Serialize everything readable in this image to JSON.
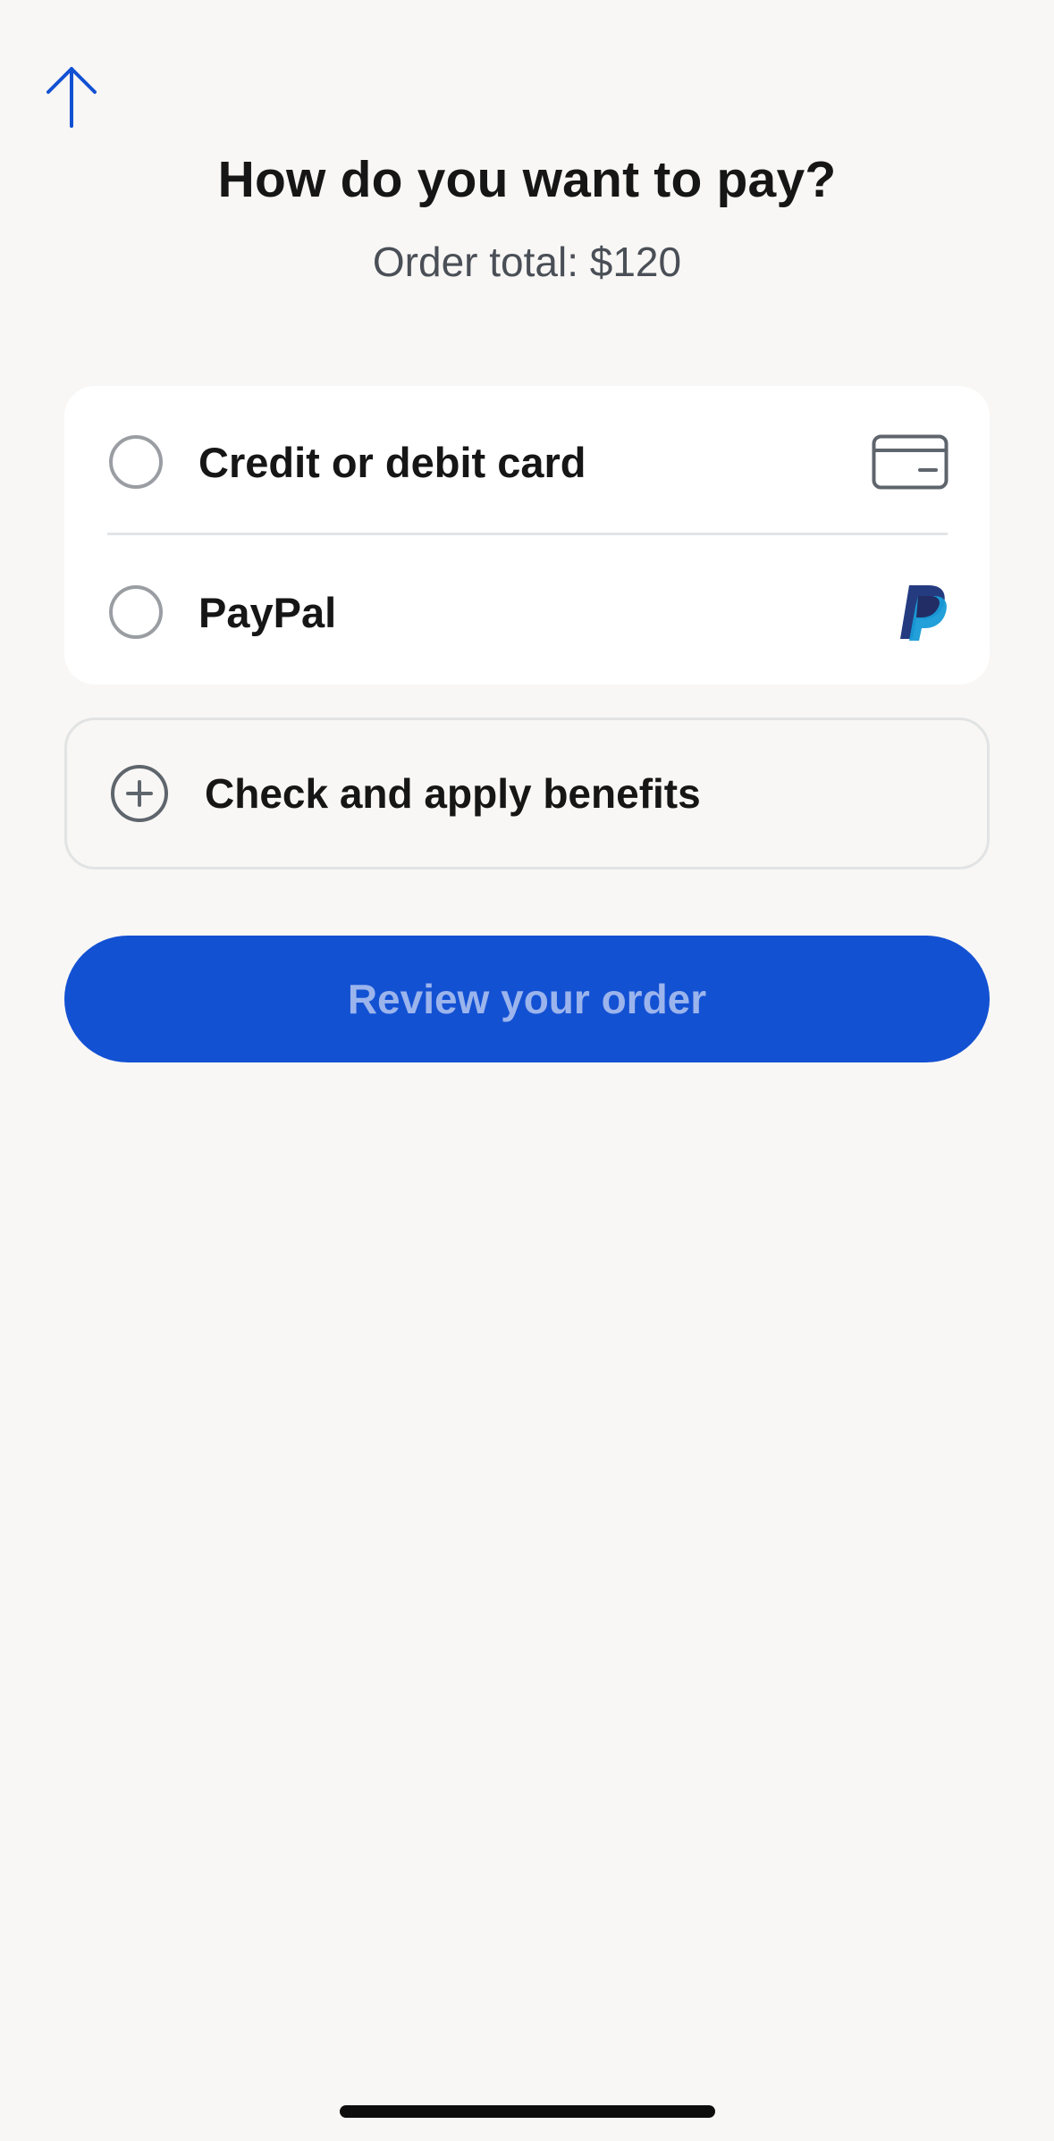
{
  "header": {
    "back_icon": "arrow-up-icon",
    "title": "How do you want to pay?",
    "order_total": "Order total: $120"
  },
  "payment_options": [
    {
      "label": "Credit or debit card",
      "icon": "credit-card-icon",
      "selected": false
    },
    {
      "label": "PayPal",
      "icon": "paypal-logo-icon",
      "selected": false
    }
  ],
  "benefits": {
    "icon": "plus-circle-icon",
    "label": "Check and apply benefits"
  },
  "review_button": {
    "label": "Review your order",
    "enabled": false
  },
  "colors": {
    "background": "#f8f7f5",
    "card": "#ffffff",
    "accent": "#1351d3",
    "button_text_disabled": "#9bb4ec",
    "text_primary": "#161616",
    "text_secondary": "#4a4f57",
    "radio_border": "#9a9ea3",
    "divider": "#e2e5e7",
    "paypal_dark": "#253b80",
    "paypal_light": "#179bd7"
  }
}
